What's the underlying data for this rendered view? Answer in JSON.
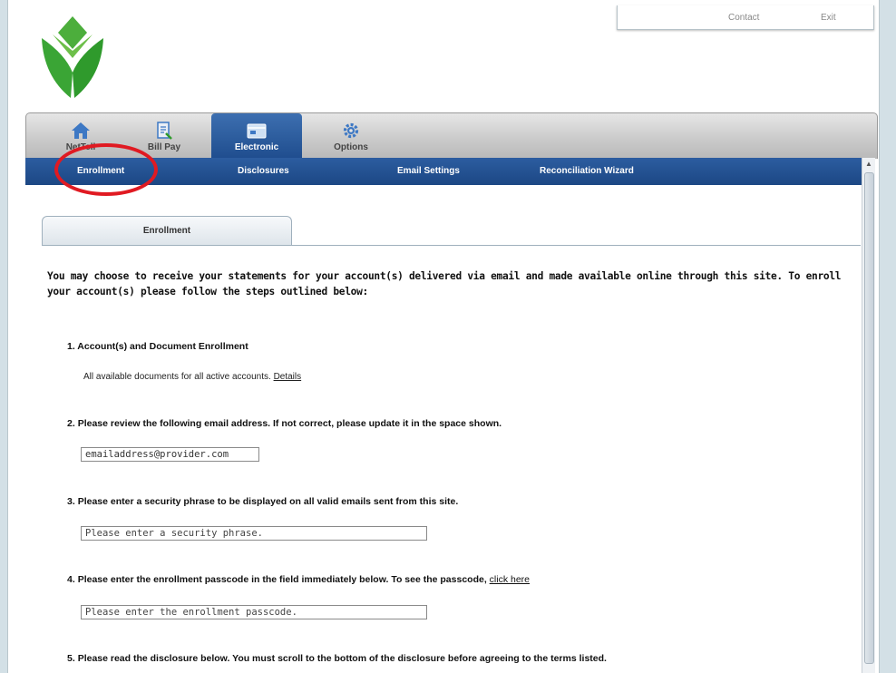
{
  "header": {
    "links": [
      {
        "label": "Contact"
      },
      {
        "label": "Exit"
      }
    ]
  },
  "nav": {
    "tabs": [
      {
        "label": "NetTell",
        "icon": "home-icon"
      },
      {
        "label": "Bill Pay",
        "icon": "bill-pay-icon"
      },
      {
        "label": "Electronic",
        "icon": "electronic-statement-icon"
      },
      {
        "label": "Options",
        "icon": "gear-icon"
      }
    ],
    "active_tab": "Electronic",
    "subtabs": [
      {
        "label": "Enrollment"
      },
      {
        "label": "Disclosures"
      },
      {
        "label": "Email Settings"
      },
      {
        "label": "Reconciliation Wizard"
      }
    ]
  },
  "content": {
    "tab_label": "Enrollment",
    "intro": "You may choose to receive your statements for your account(s) delivered via email and made available online through this site. To enroll your account(s) please follow the steps outlined below:",
    "steps": [
      {
        "number": "1.",
        "text": "Account(s) and Document Enrollment",
        "sub_text": "All available documents for all active accounts.",
        "link": "Details"
      },
      {
        "number": "2.",
        "text": "Please review the following email address. If not correct, please update it in the space shown.",
        "field_value": "emailaddress@provider.com"
      },
      {
        "number": "3.",
        "text": "Please enter a security phrase to be displayed on all valid emails sent from this site.",
        "placeholder": "Please enter a security phrase."
      },
      {
        "number": "4.",
        "text": "Please enter the enrollment passcode in the field immediately below. To see the passcode,",
        "link": "click here",
        "placeholder": "Please enter the enrollment passcode."
      },
      {
        "number": "5.",
        "text": "Please read the disclosure below. You must scroll to the bottom of the disclosure before agreeing to the terms listed."
      }
    ]
  },
  "colors": {
    "nav_active": "#1f4d8e",
    "subnav": "#1c4784",
    "highlight_circle": "#e01a22",
    "logo_green": "#3aa535"
  }
}
